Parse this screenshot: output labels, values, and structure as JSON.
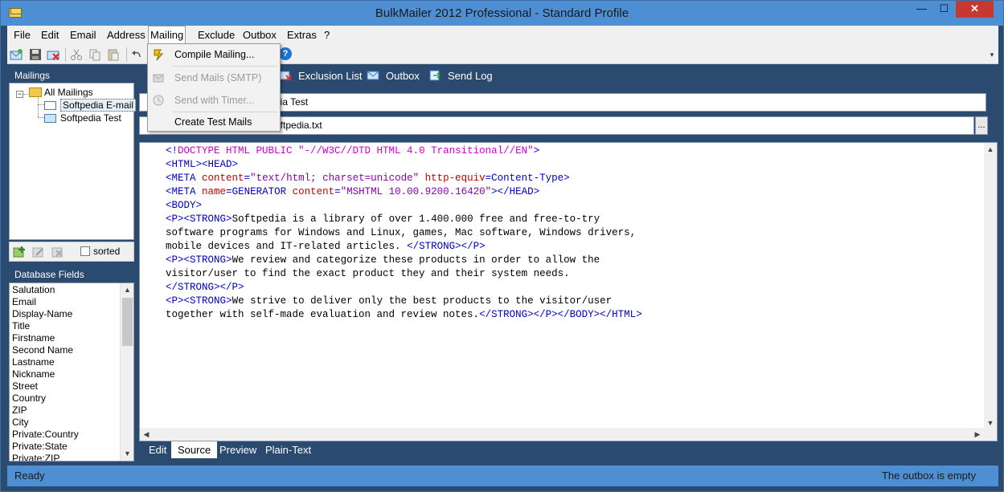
{
  "window": {
    "title": "BulkMailer 2012 Professional - Standard Profile",
    "min_glyph": "—",
    "max_glyph": "☐",
    "close_glyph": "✕"
  },
  "menubar": {
    "items": [
      "File",
      "Edit",
      "Email",
      "Address",
      "Mailing",
      "Exclude",
      "Outbox",
      "Extras",
      "?"
    ],
    "active": "Mailing"
  },
  "toolbar": {
    "help_glyph": "?",
    "overflow_glyph": "▾"
  },
  "mailings_panel": {
    "header": "Mailings",
    "root": "All Mailings",
    "children": [
      "Softpedia E-mail",
      "Softpedia Test"
    ],
    "selected": "Softpedia E-mail",
    "sorted_label": "sorted"
  },
  "fields_panel": {
    "header": "Database Fields",
    "fields": [
      "Salutation",
      "Email",
      "Display-Name",
      "Title",
      "Firstname",
      "Second Name",
      "Lastname",
      "Nickname",
      "Street",
      "Country",
      "ZIP",
      "City",
      "Private:Country",
      "Private:State",
      "Private:ZIP"
    ]
  },
  "main_tabs": [
    "Exclusion List",
    "Outbox",
    "Send Log"
  ],
  "subject_value": "dia Test",
  "attachment_value": "oftpedia.txt",
  "browse_label": "...",
  "editor": {
    "lines": [
      "<!DOCTYPE HTML PUBLIC \"-//W3C//DTD HTML 4.0 Transitional//EN\">",
      "<HTML><HEAD>",
      "<META content=\"text/html; charset=unicode\" http-equiv=Content-Type>",
      "<META name=GENERATOR content=\"MSHTML 10.00.9200.16420\"></HEAD>",
      "<BODY>",
      "<P><STRONG>Softpedia is a library of over 1.400.000 free and free-to-try",
      "software programs for Windows and Linux, games, Mac software, Windows drivers,",
      "mobile devices and IT-related articles. </STRONG></P>",
      "<P><STRONG>We review and categorize these products in order to allow the",
      "visitor/user to find the exact product they and their system needs.",
      "</STRONG></P>",
      "<P><STRONG>We strive to deliver only the best products to the visitor/user",
      "together with self-made evaluation and review notes.</STRONG></P></BODY></HTML>"
    ]
  },
  "bottom_tabs": [
    "Edit",
    "Source",
    "Preview",
    "Plain-Text"
  ],
  "bottom_active": "Source",
  "status": {
    "left": "Ready",
    "right": "The outbox is empty"
  },
  "dropdown": {
    "items": [
      {
        "label": "Compile Mailing...",
        "enabled": true,
        "icon": "compile-icon"
      },
      {
        "label": "Send Mails (SMTP)",
        "enabled": false,
        "icon": "send-icon"
      },
      {
        "label": "Send with Timer...",
        "enabled": false,
        "icon": "timer-icon"
      },
      {
        "label": "Create Test Mails",
        "enabled": true,
        "icon": ""
      }
    ]
  },
  "colors": {
    "titlebar": "#4e8fd3",
    "frame": "#2b4a70",
    "close": "#c7382e",
    "tag": "#0000c8",
    "attr": "#c80000",
    "string": "#8b00b0"
  }
}
